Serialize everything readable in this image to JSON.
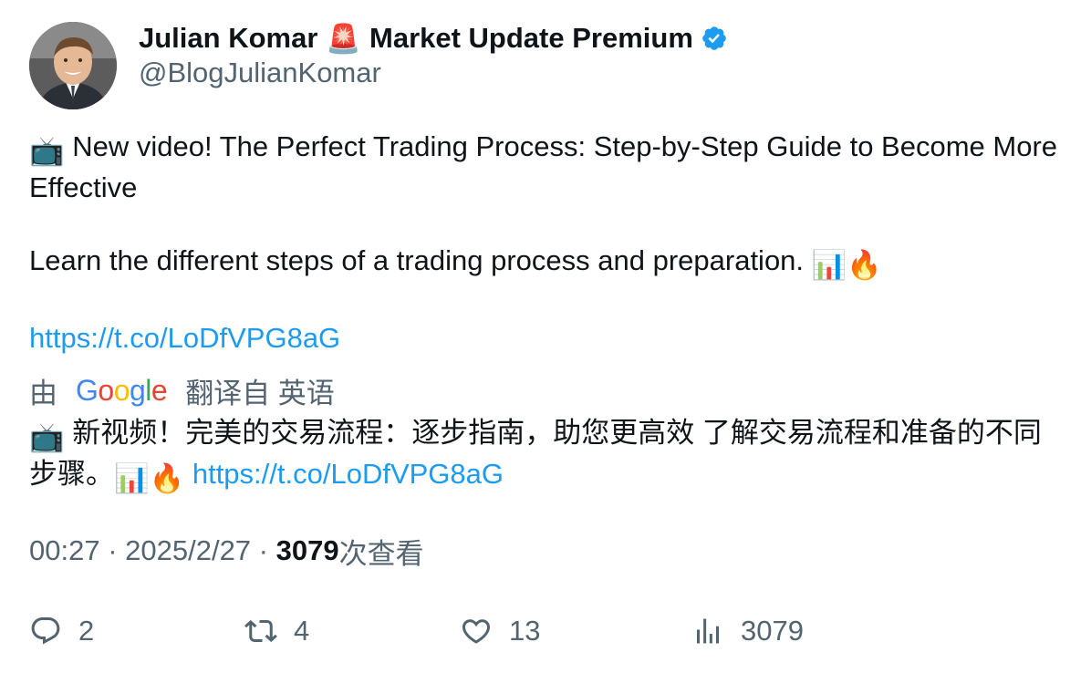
{
  "author": {
    "display_name_part1": "Julian Komar",
    "siren_emoji": "🚨",
    "display_name_part2": "Market Update Premium",
    "handle": "@BlogJulianKomar",
    "verified_icon": "verified-badge-icon",
    "avatar_icon": "profile-photo"
  },
  "tweet": {
    "line1": "New video! The Perfect Trading Process: Step-by-Step Guide to Become More Effective",
    "tv_emoji": "📺",
    "line2": "Learn the different steps of a trading process and preparation.",
    "chart_emoji": "📊",
    "fire_emoji": "🔥",
    "link": "https://t.co/LoDfVPG8aG"
  },
  "translation": {
    "by": "由",
    "google_letters": [
      "G",
      "o",
      "o",
      "g",
      "l",
      "e"
    ],
    "google_colors": [
      "#4285f4",
      "#ea4335",
      "#fbbc05",
      "#4285f4",
      "#34a853",
      "#ea4335"
    ],
    "from": "翻译自 英语",
    "text": "新视频！完美的交易流程：逐步指南，助您更高效 了解交易流程和准备的不同步骤。",
    "link": "https://t.co/LoDfVPG8aG"
  },
  "meta": {
    "time": "00:27",
    "separator": " · ",
    "date": "2025/2/27",
    "views_count": "3079",
    "views_label": "次查看"
  },
  "actions": {
    "replies": "2",
    "retweets": "4",
    "likes": "13",
    "views": "3079"
  },
  "colors": {
    "link": "#1d9bf0",
    "secondary_text": "#536471",
    "primary_text": "#0f1419",
    "verified": "#1d9bf0"
  }
}
